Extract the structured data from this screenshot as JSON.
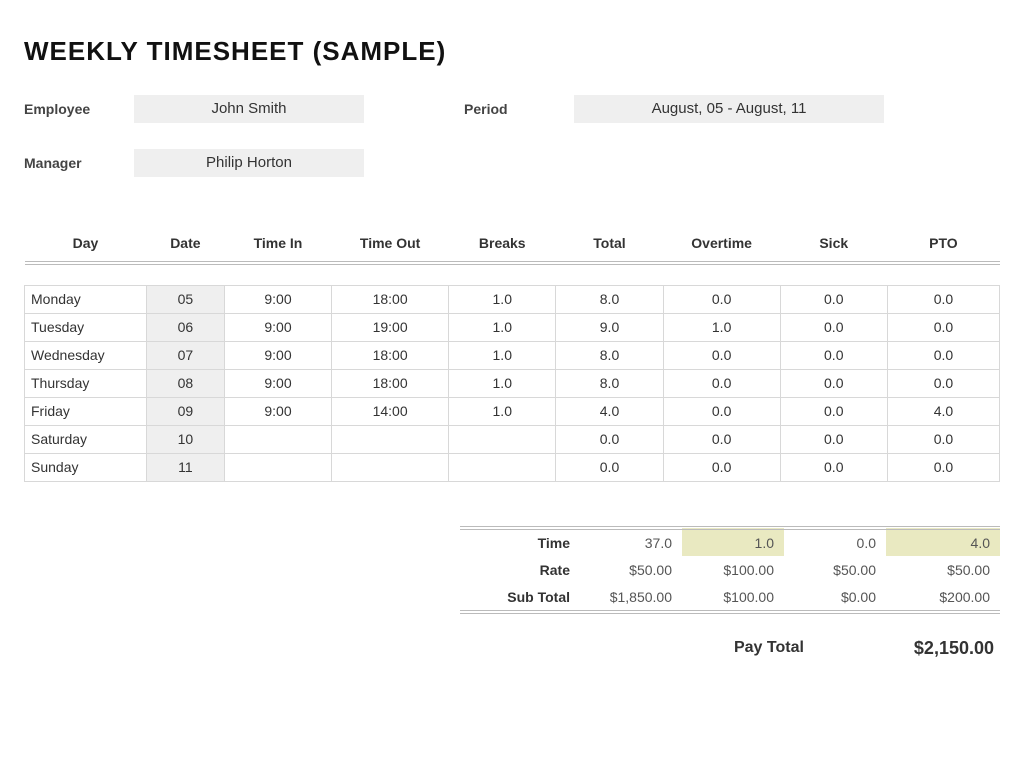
{
  "title": "WEEKLY TIMESHEET (SAMPLE)",
  "meta": {
    "employee_label": "Employee",
    "employee_value": "John Smith",
    "period_label": "Period",
    "period_value": "August, 05 - August, 11",
    "manager_label": "Manager",
    "manager_value": "Philip Horton"
  },
  "headers": {
    "day": "Day",
    "date": "Date",
    "time_in": "Time In",
    "time_out": "Time Out",
    "breaks": "Breaks",
    "total": "Total",
    "overtime": "Overtime",
    "sick": "Sick",
    "pto": "PTO"
  },
  "rows": [
    {
      "day": "Monday",
      "date": "05",
      "time_in": "9:00",
      "time_out": "18:00",
      "breaks": "1.0",
      "total": "8.0",
      "overtime": "0.0",
      "sick": "0.0",
      "pto": "0.0"
    },
    {
      "day": "Tuesday",
      "date": "06",
      "time_in": "9:00",
      "time_out": "19:00",
      "breaks": "1.0",
      "total": "9.0",
      "overtime": "1.0",
      "sick": "0.0",
      "pto": "0.0"
    },
    {
      "day": "Wednesday",
      "date": "07",
      "time_in": "9:00",
      "time_out": "18:00",
      "breaks": "1.0",
      "total": "8.0",
      "overtime": "0.0",
      "sick": "0.0",
      "pto": "0.0"
    },
    {
      "day": "Thursday",
      "date": "08",
      "time_in": "9:00",
      "time_out": "18:00",
      "breaks": "1.0",
      "total": "8.0",
      "overtime": "0.0",
      "sick": "0.0",
      "pto": "0.0"
    },
    {
      "day": "Friday",
      "date": "09",
      "time_in": "9:00",
      "time_out": "14:00",
      "breaks": "1.0",
      "total": "4.0",
      "overtime": "0.0",
      "sick": "0.0",
      "pto": "4.0"
    },
    {
      "day": "Saturday",
      "date": "10",
      "time_in": "",
      "time_out": "",
      "breaks": "",
      "total": "0.0",
      "overtime": "0.0",
      "sick": "0.0",
      "pto": "0.0"
    },
    {
      "day": "Sunday",
      "date": "11",
      "time_in": "",
      "time_out": "",
      "breaks": "",
      "total": "0.0",
      "overtime": "0.0",
      "sick": "0.0",
      "pto": "0.0"
    }
  ],
  "summary": {
    "time_label": "Time",
    "rate_label": "Rate",
    "subtotal_label": "Sub Total",
    "time": {
      "total": "37.0",
      "overtime": "1.0",
      "sick": "0.0",
      "pto": "4.0"
    },
    "rate": {
      "total": "$50.00",
      "overtime": "$100.00",
      "sick": "$50.00",
      "pto": "$50.00"
    },
    "subtotal": {
      "total": "$1,850.00",
      "overtime": "$100.00",
      "sick": "$0.00",
      "pto": "$200.00"
    }
  },
  "pay_total": {
    "label": "Pay Total",
    "value": "$2,150.00"
  }
}
